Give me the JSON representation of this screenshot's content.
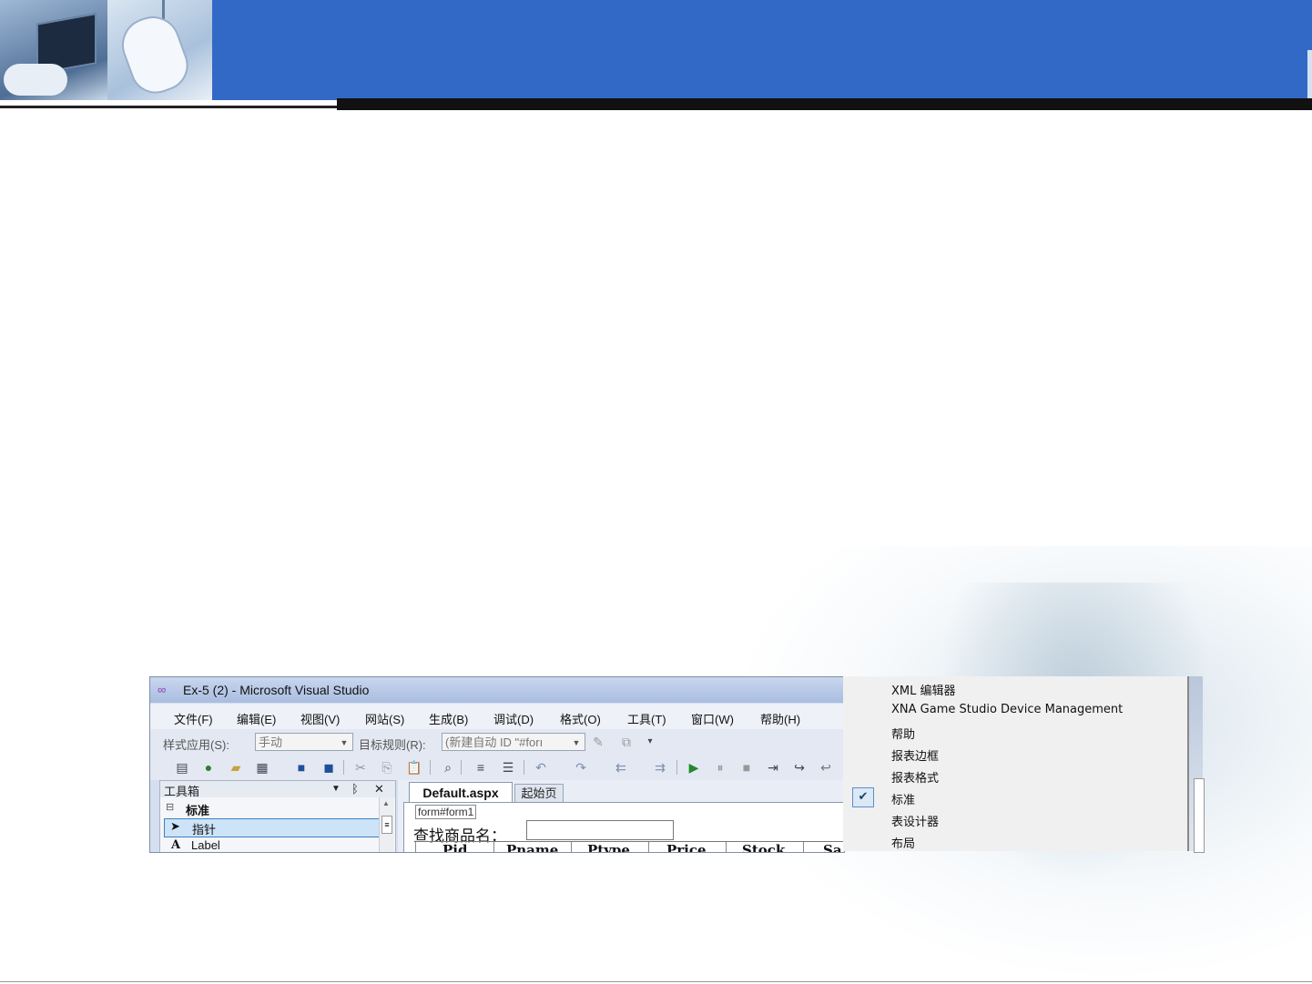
{
  "vs": {
    "title": "Ex-5 (2) - Microsoft Visual Studio",
    "menu": [
      "文件(F)",
      "编辑(E)",
      "视图(V)",
      "网站(S)",
      "生成(B)",
      "调试(D)",
      "格式(O)",
      "工具(T)",
      "窗口(W)",
      "帮助(H)"
    ],
    "toolbar1": {
      "style_label": "样式应用(S):",
      "style_value": "手动",
      "target_label": "目标规则(R):",
      "target_value": "(新建自动 ID \"#forı"
    },
    "toolbox": {
      "title": "工具箱",
      "pin": "ᛒ",
      "close": "✕",
      "group": "标准",
      "items": [
        "指针",
        "Label"
      ]
    },
    "editor": {
      "tab_active": "Default.aspx",
      "tab_other": "起始页",
      "form_tag": "form#form1",
      "find_label": "查找商品名：",
      "columns": [
        "Pid",
        "Pname",
        "Ptype",
        "Price",
        "Stock",
        "Sa"
      ]
    }
  },
  "context_menu": {
    "items": [
      "XML 编辑器",
      "XNA Game Studio Device Management",
      "帮助",
      "报表边框",
      "报表格式",
      "标准",
      "表设计器",
      "布局"
    ],
    "checked_item": "标准"
  }
}
